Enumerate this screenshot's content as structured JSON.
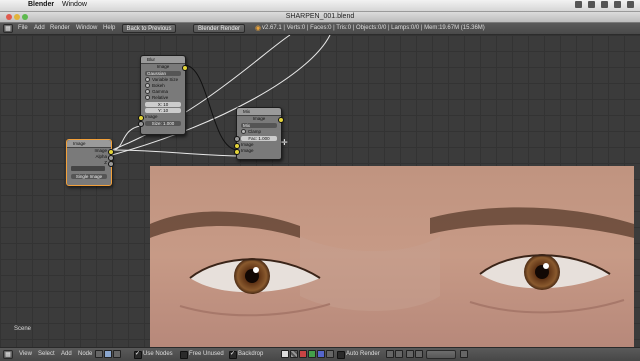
{
  "mac_menubar": {
    "app": "Blender",
    "window": "Window"
  },
  "window": {
    "title": "SHARPEN_001.blend"
  },
  "header": {
    "menus": [
      "File",
      "Add",
      "Render",
      "Window",
      "Help"
    ],
    "back_button": "Back to Previous",
    "engine": "Blender Render",
    "stats": "v2.67.1 | Verts:0 | Faces:0 | Tris:0 | Objects:0/0 | Lamps:0/0 | Mem:19.67M (15.36M)"
  },
  "nodes": {
    "image": {
      "title": "Image",
      "outputs": [
        "Image",
        "Alpha",
        "Z"
      ],
      "source": "Single Image"
    },
    "blur1": {
      "title": "Blur",
      "out_label": "Image",
      "filter": "Gaussian",
      "options": [
        "Variable Size",
        "Bokeh",
        "Gamma",
        "Relative"
      ],
      "x": "X: 10",
      "y": "Y: 10",
      "in_image": "Image",
      "size": "Size: 1.000"
    },
    "mix": {
      "title": "Mix",
      "out_label": "Image",
      "blend": "Mix",
      "clamp": "Clamp",
      "fac": "Fac: 1.000",
      "in1": "Image",
      "in2": "Image"
    }
  },
  "editor": {
    "scene_label": "Scene"
  },
  "footer": {
    "menus": [
      "View",
      "Select",
      "Add",
      "Node"
    ],
    "use_nodes": "Use Nodes",
    "free_unused": "Free Unused",
    "backdrop": "Backdrop",
    "auto_render": "Auto Render"
  },
  "colors": {
    "socket_image": "#e3d43a",
    "socket_value": "#999999",
    "node_selected": "#f2a03a"
  }
}
